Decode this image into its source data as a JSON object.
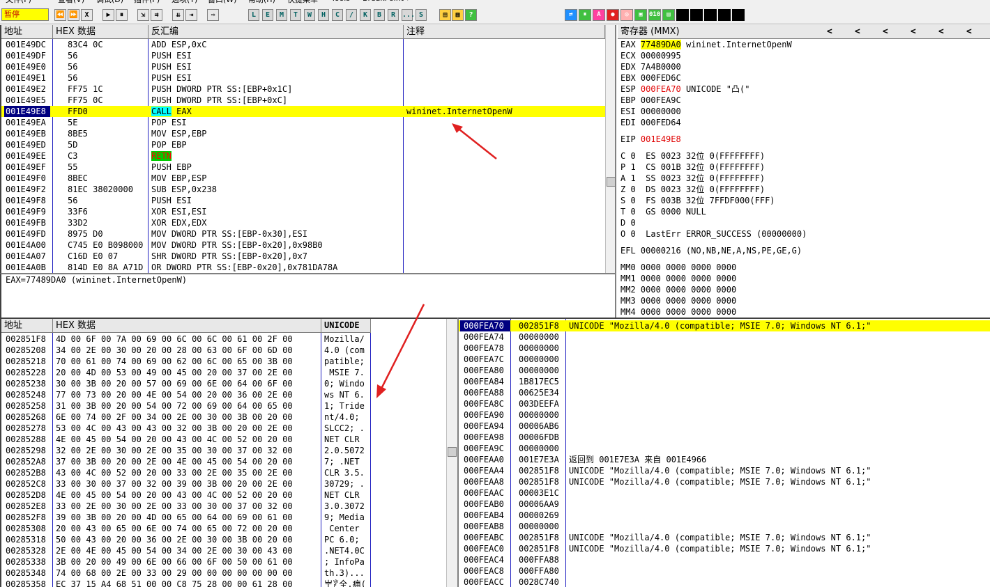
{
  "menu": [
    "文件(F)",
    "查看(V)",
    "调试(D)",
    "插件(P)",
    "选项(T)",
    "窗口(W)",
    "帮助(H)",
    "快捷菜单",
    "Tools",
    "BreakPoint->"
  ],
  "toolbar": {
    "status": "暂停",
    "buttons_left": [
      "⏪",
      "⏩",
      "X",
      "▶",
      "⏸",
      "⇲",
      "⇉",
      "⇊",
      "⇥",
      "⇨"
    ],
    "letter_buttons": [
      "L",
      "E",
      "M",
      "T",
      "W",
      "H",
      "C",
      "/",
      "K",
      "B",
      "R",
      "...",
      "S"
    ],
    "icons_right": [
      "⇄",
      "⏸",
      "A",
      "●",
      "◎",
      "▣",
      "010",
      "▤"
    ]
  },
  "disasm": {
    "headers": {
      "addr": "地址",
      "hex": "HEX 数据",
      "asm": "反汇编",
      "comment": "注释"
    },
    "rows": [
      {
        "addr": "001E49DC",
        "hex": "83C4 0C",
        "asm": "ADD ESP,0xC",
        "comment": ""
      },
      {
        "addr": "001E49DF",
        "hex": "56",
        "asm": "PUSH ESI",
        "comment": ""
      },
      {
        "addr": "001E49E0",
        "hex": "56",
        "asm": "PUSH ESI",
        "comment": ""
      },
      {
        "addr": "001E49E1",
        "hex": "56",
        "asm": "PUSH ESI",
        "comment": ""
      },
      {
        "addr": "001E49E2",
        "hex": "FF75 1C",
        "asm": "PUSH DWORD PTR SS:[EBP+0x1C]",
        "comment": ""
      },
      {
        "addr": "001E49E5",
        "hex": "FF75 0C",
        "asm": "PUSH DWORD PTR SS:[EBP+0xC]",
        "comment": ""
      },
      {
        "addr": "001E49E8",
        "hex": "FFD0",
        "asm_op": "CALL",
        "asm_rest": " EAX",
        "comment": "wininet.InternetOpenW",
        "current": true
      },
      {
        "addr": "001E49EA",
        "hex": "5E",
        "asm": "POP ESI",
        "comment": ""
      },
      {
        "addr": "001E49EB",
        "hex": "8BE5",
        "asm": "MOV ESP,EBP",
        "comment": ""
      },
      {
        "addr": "001E49ED",
        "hex": "5D",
        "asm": "POP EBP",
        "comment": ""
      },
      {
        "addr": "001E49EE",
        "hex": "C3",
        "asm_ret": "RETN",
        "comment": ""
      },
      {
        "addr": "001E49EF",
        "hex": "55",
        "asm": "PUSH EBP",
        "comment": ""
      },
      {
        "addr": "001E49F0",
        "hex": "8BEC",
        "asm": "MOV EBP,ESP",
        "comment": ""
      },
      {
        "addr": "001E49F2",
        "hex": "81EC 38020000",
        "asm": "SUB ESP,0x238",
        "comment": ""
      },
      {
        "addr": "001E49F8",
        "hex": "56",
        "asm": "PUSH ESI",
        "comment": ""
      },
      {
        "addr": "001E49F9",
        "hex": "33F6",
        "asm": "XOR ESI,ESI",
        "comment": ""
      },
      {
        "addr": "001E49FB",
        "hex": "33D2",
        "asm": "XOR EDX,EDX",
        "comment": ""
      },
      {
        "addr": "001E49FD",
        "hex": "8975 D0",
        "asm": "MOV DWORD PTR SS:[EBP-0x30],ESI",
        "comment": ""
      },
      {
        "addr": "001E4A00",
        "hex": "C745 E0 B098000",
        "asm": "MOV DWORD PTR SS:[EBP-0x20],0x98B0",
        "comment": ""
      },
      {
        "addr": "001E4A07",
        "hex": "C16D E0 07",
        "asm": "SHR DWORD PTR SS:[EBP-0x20],0x7",
        "comment": ""
      },
      {
        "addr": "001E4A0B",
        "hex": "814D E0 8A A71D",
        "asm": "OR DWORD PTR SS:[EBP-0x20],0x781DA78A",
        "comment": ""
      }
    ],
    "info": "EAX=77489DA0 (wininet.InternetOpenW)"
  },
  "registers": {
    "title": "寄存器 (MMX)",
    "nav": [
      "<",
      "<",
      "<",
      "<",
      "<",
      "<"
    ],
    "gp": [
      {
        "name": "EAX",
        "val": "77489DA0",
        "note": "wininet.InternetOpenW",
        "hl": "yellow"
      },
      {
        "name": "ECX",
        "val": "00000995",
        "note": ""
      },
      {
        "name": "EDX",
        "val": "7A4B0000",
        "note": ""
      },
      {
        "name": "EBX",
        "val": "000FED6C",
        "note": ""
      },
      {
        "name": "ESP",
        "val": "000FEA70",
        "note": "UNICODE \"凸(\"",
        "hl": "red"
      },
      {
        "name": "EBP",
        "val": "000FEA9C",
        "note": ""
      },
      {
        "name": "ESI",
        "val": "00000000",
        "note": ""
      },
      {
        "name": "EDI",
        "val": "000FED64",
        "note": ""
      }
    ],
    "eip": {
      "name": "EIP",
      "val": "001E49E8"
    },
    "flags": [
      "C 0  ES 0023 32位 0(FFFFFFFF)",
      "P 1  CS 001B 32位 0(FFFFFFFF)",
      "A 1  SS 0023 32位 0(FFFFFFFF)",
      "Z 0  DS 0023 32位 0(FFFFFFFF)",
      "S 0  FS 003B 32位 7FFDF000(FFF)",
      "T 0  GS 0000 NULL",
      "D 0",
      "O 0  LastErr ERROR_SUCCESS (00000000)"
    ],
    "efl": "EFL 00000216 (NO,NB,NE,A,NS,PE,GE,G)",
    "mmx": [
      "MM0 0000 0000 0000 0000",
      "MM1 0000 0000 0000 0000",
      "MM2 0000 0000 0000 0000",
      "MM3 0000 0000 0000 0000",
      "MM4 0000 0000 0000 0000"
    ]
  },
  "dump": {
    "headers": {
      "addr": "地址",
      "hex": "HEX 数据",
      "text": "UNICODE"
    },
    "rows": [
      {
        "addr": "002851F8",
        "hex": "4D 00 6F 00 7A 00 69 00 6C 00 6C 00 61 00 2F 00",
        "text": "Mozilla/"
      },
      {
        "addr": "00285208",
        "hex": "34 00 2E 00 30 00 20 00 28 00 63 00 6F 00 6D 00",
        "text": "4.0 (com"
      },
      {
        "addr": "00285218",
        "hex": "70 00 61 00 74 00 69 00 62 00 6C 00 65 00 3B 00",
        "text": "patible;"
      },
      {
        "addr": "00285228",
        "hex": "20 00 4D 00 53 00 49 00 45 00 20 00 37 00 2E 00",
        "text": " MSIE 7."
      },
      {
        "addr": "00285238",
        "hex": "30 00 3B 00 20 00 57 00 69 00 6E 00 64 00 6F 00",
        "text": "0; Windo"
      },
      {
        "addr": "00285248",
        "hex": "77 00 73 00 20 00 4E 00 54 00 20 00 36 00 2E 00",
        "text": "ws NT 6."
      },
      {
        "addr": "00285258",
        "hex": "31 00 3B 00 20 00 54 00 72 00 69 00 64 00 65 00",
        "text": "1; Tride"
      },
      {
        "addr": "00285268",
        "hex": "6E 00 74 00 2F 00 34 00 2E 00 30 00 3B 00 20 00",
        "text": "nt/4.0; "
      },
      {
        "addr": "00285278",
        "hex": "53 00 4C 00 43 00 43 00 32 00 3B 00 20 00 2E 00",
        "text": "SLCC2; ."
      },
      {
        "addr": "00285288",
        "hex": "4E 00 45 00 54 00 20 00 43 00 4C 00 52 00 20 00",
        "text": "NET CLR "
      },
      {
        "addr": "00285298",
        "hex": "32 00 2E 00 30 00 2E 00 35 00 30 00 37 00 32 00",
        "text": "2.0.5072"
      },
      {
        "addr": "002852A8",
        "hex": "37 00 3B 00 20 00 2E 00 4E 00 45 00 54 00 20 00",
        "text": "7; .NET "
      },
      {
        "addr": "002852B8",
        "hex": "43 00 4C 00 52 00 20 00 33 00 2E 00 35 00 2E 00",
        "text": "CLR 3.5."
      },
      {
        "addr": "002852C8",
        "hex": "33 00 30 00 37 00 32 00 39 00 3B 00 20 00 2E 00",
        "text": "30729; ."
      },
      {
        "addr": "002852D8",
        "hex": "4E 00 45 00 54 00 20 00 43 00 4C 00 52 00 20 00",
        "text": "NET CLR "
      },
      {
        "addr": "002852E8",
        "hex": "33 00 2E 00 30 00 2E 00 33 00 30 00 37 00 32 00",
        "text": "3.0.3072"
      },
      {
        "addr": "002852F8",
        "hex": "39 00 3B 00 20 00 4D 00 65 00 64 00 69 00 61 00",
        "text": "9; Media"
      },
      {
        "addr": "00285308",
        "hex": "20 00 43 00 65 00 6E 00 74 00 65 00 72 00 20 00",
        "text": " Center "
      },
      {
        "addr": "00285318",
        "hex": "50 00 43 00 20 00 36 00 2E 00 30 00 3B 00 20 00",
        "text": "PC 6.0; "
      },
      {
        "addr": "00285328",
        "hex": "2E 00 4E 00 45 00 54 00 34 00 2E 00 30 00 43 00",
        "text": ".NET4.0C"
      },
      {
        "addr": "00285338",
        "hex": "3B 00 20 00 49 00 6E 00 66 00 6F 00 50 00 61 00",
        "text": "; InfoPa"
      },
      {
        "addr": "00285348",
        "hex": "74 00 68 00 2E 00 33 00 29 00 00 00 00 00 00 00",
        "text": "th.3)..."
      },
      {
        "addr": "00285358",
        "hex": "EC 37 15 A4 68 51 00 00 C8 75 28 00 00 61 28 00",
        "text": "㞬ꐕ全.痈("
      }
    ]
  },
  "stack": {
    "rows": [
      {
        "addr": "000FEA70",
        "val": "002851F8",
        "note": "UNICODE \"Mozilla/4.0 (compatible; MSIE 7.0; Windows NT 6.1;\"",
        "current": true
      },
      {
        "addr": "000FEA74",
        "val": "00000000",
        "note": ""
      },
      {
        "addr": "000FEA78",
        "val": "00000000",
        "note": ""
      },
      {
        "addr": "000FEA7C",
        "val": "00000000",
        "note": ""
      },
      {
        "addr": "000FEA80",
        "val": "00000000",
        "note": ""
      },
      {
        "addr": "000FEA84",
        "val": "1B817EC5",
        "note": ""
      },
      {
        "addr": "000FEA88",
        "val": "00625E34",
        "note": ""
      },
      {
        "addr": "000FEA8C",
        "val": "003DEEFA",
        "note": ""
      },
      {
        "addr": "000FEA90",
        "val": "00000000",
        "note": ""
      },
      {
        "addr": "000FEA94",
        "val": "00006AB6",
        "note": ""
      },
      {
        "addr": "000FEA98",
        "val": "00006FDB",
        "note": ""
      },
      {
        "addr": "000FEA9C",
        "val": "00000000",
        "note": ""
      },
      {
        "addr": "000FEAA0",
        "val": "001E7E3A",
        "note": "返回到 001E7E3A 来自 001E4966"
      },
      {
        "addr": "000FEAA4",
        "val": "002851F8",
        "note": "UNICODE \"Mozilla/4.0 (compatible; MSIE 7.0; Windows NT 6.1;\""
      },
      {
        "addr": "000FEAA8",
        "val": "002851F8",
        "note": "UNICODE \"Mozilla/4.0 (compatible; MSIE 7.0; Windows NT 6.1;\""
      },
      {
        "addr": "000FEAAC",
        "val": "00003E1C",
        "note": ""
      },
      {
        "addr": "000FEAB0",
        "val": "00006AA9",
        "note": ""
      },
      {
        "addr": "000FEAB4",
        "val": "00000269",
        "note": ""
      },
      {
        "addr": "000FEAB8",
        "val": "00000000",
        "note": ""
      },
      {
        "addr": "000FEABC",
        "val": "002851F8",
        "note": "UNICODE \"Mozilla/4.0 (compatible; MSIE 7.0; Windows NT 6.1;\""
      },
      {
        "addr": "000FEAC0",
        "val": "002851F8",
        "note": "UNICODE \"Mozilla/4.0 (compatible; MSIE 7.0; Windows NT 6.1;\""
      },
      {
        "addr": "000FEAC4",
        "val": "000FFA88",
        "note": ""
      },
      {
        "addr": "000FEAC8",
        "val": "000FFA80",
        "note": ""
      },
      {
        "addr": "000FEACC",
        "val": "0028C740",
        "note": ""
      }
    ]
  },
  "colors": {
    "highlight": "#ffff00",
    "selection": "#000080",
    "arrow": "#e02020",
    "red_text": "#e00000",
    "divider": "#2020c0"
  }
}
